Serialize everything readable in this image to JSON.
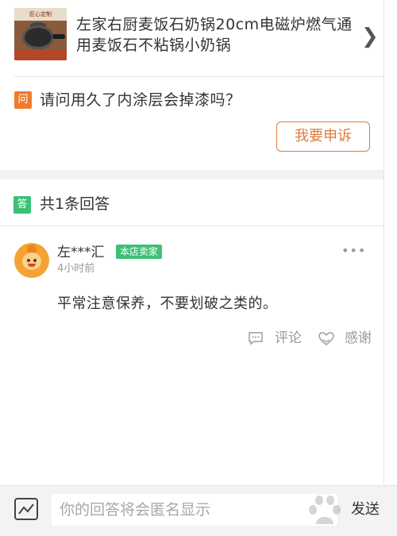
{
  "product": {
    "title": "左家右厨麦饭石奶锅20cm电磁炉燃气通用麦饭石不粘锅小奶锅",
    "thumb_caption": "匠心定制"
  },
  "question": {
    "icon_label": "问",
    "text": "请问用久了内涂层会掉漆吗？",
    "appeal_button": "我要申诉"
  },
  "answers": {
    "icon_label": "答",
    "count_label": "共1条回答",
    "items": [
      {
        "user": "左***汇",
        "badge": "本店卖家",
        "time": "4小时前",
        "text": "平常注意保养，不要划破之类的。",
        "actions": {
          "comment": "评论",
          "thanks": "感谢"
        }
      }
    ]
  },
  "reply_bar": {
    "placeholder": "你的回答将会匿名显示",
    "send_label": "发送"
  },
  "colors": {
    "question_icon": "#ef7b2f",
    "answer_icon": "#3cc075",
    "accent": "#e07a3b"
  }
}
